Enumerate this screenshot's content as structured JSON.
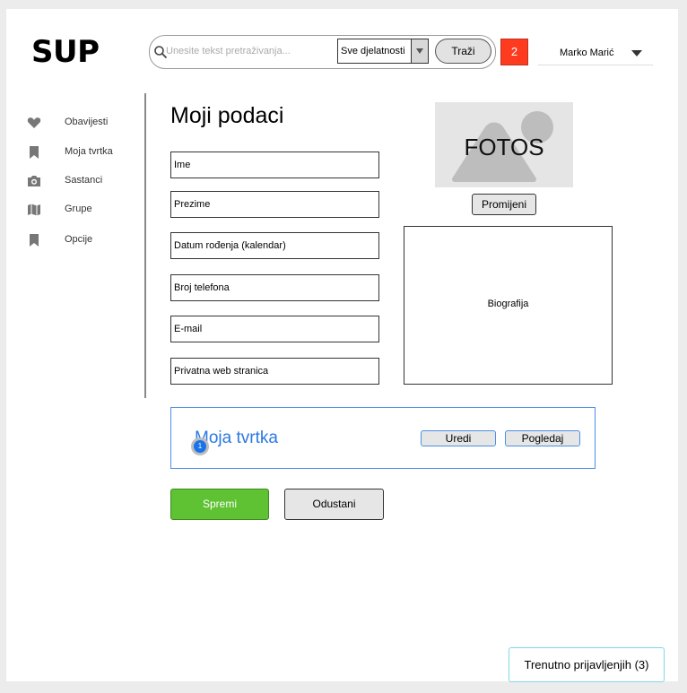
{
  "header": {
    "logo": "SUP",
    "search": {
      "placeholder": "Unesite tekst pretraživanja..."
    },
    "category_select": {
      "selected": "Sve djelatnosti"
    },
    "search_button": "Traži",
    "notification_count": "2",
    "user_name": "Marko Marić"
  },
  "sidebar": {
    "items": [
      {
        "label": "Obavijesti",
        "icon": "heart-icon"
      },
      {
        "label": "Moja tvrtka",
        "icon": "bookmark-icon"
      },
      {
        "label": "Sastanci",
        "icon": "camera-icon"
      },
      {
        "label": "Grupe",
        "icon": "map-icon"
      },
      {
        "label": "Opcije",
        "icon": "bookmark-icon"
      }
    ]
  },
  "main": {
    "title": "Moji podaci",
    "fields": [
      "Ime",
      "Prezime",
      "Datum rođenja (kalendar)",
      "Broj telefona",
      "E-mail",
      "Privatna web stranica"
    ],
    "photo_label": "FOTOS",
    "change_photo_button": "Promijeni",
    "bio_label": "Biografija",
    "company": {
      "title": "Moja tvrtka",
      "badge": "1",
      "edit_button": "Uredi",
      "view_button": "Pogledaj"
    },
    "save_button": "Spremi",
    "cancel_button": "Odustani"
  },
  "online_users": "Trenutno prijavljenjih (3)",
  "colors": {
    "notification": "#ff3b1f",
    "save": "#5ec233",
    "company_accent": "#2b78e4"
  }
}
